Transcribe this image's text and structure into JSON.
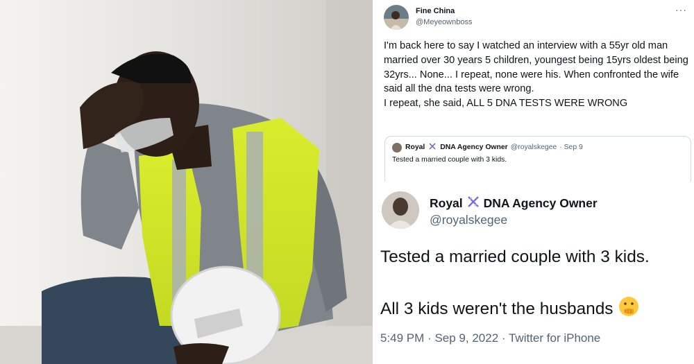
{
  "tweet": {
    "name": "Fine China",
    "handle": "@Meyeownboss",
    "more_icon": "more-horizontal-icon",
    "body_para1": "I'm back here to say I watched an interview with a 55yr old man married over 30 years 5 children, youngest being 15yrs oldest being 32yrs... None... I repeat, none were his. When confronted the wife said all the dna tests were wrong.",
    "body_para2": "I repeat, she said, ALL 5 DNA TESTS WERE WRONG"
  },
  "quoted_tweet": {
    "name_prefix": "Royal",
    "name_suffix": "DNA Agency Owner",
    "handle": "@royalskegee",
    "date": "· Sep 9",
    "text": "Tested a married couple with 3 kids."
  },
  "zoomed_tweet": {
    "name_prefix": "Royal",
    "name_suffix": "DNA Agency Owner",
    "handle": "@royalskegee",
    "line1": "Tested a married couple with 3 kids.",
    "line2": "All 3 kids weren't the husbands",
    "emoji_icon": "hand-over-mouth-emoji-icon",
    "dna_icon": "dna-icon",
    "time": "5:49 PM",
    "date": "Sep 9, 2022",
    "source": "Twitter for iPhone",
    "meta_sep": "·"
  },
  "colors": {
    "text_primary": "#0f1419",
    "text_secondary": "#536471",
    "border": "#cfd9de",
    "vest_yellow": "#d4e82a",
    "dna_purple": "#7b6fd6"
  }
}
